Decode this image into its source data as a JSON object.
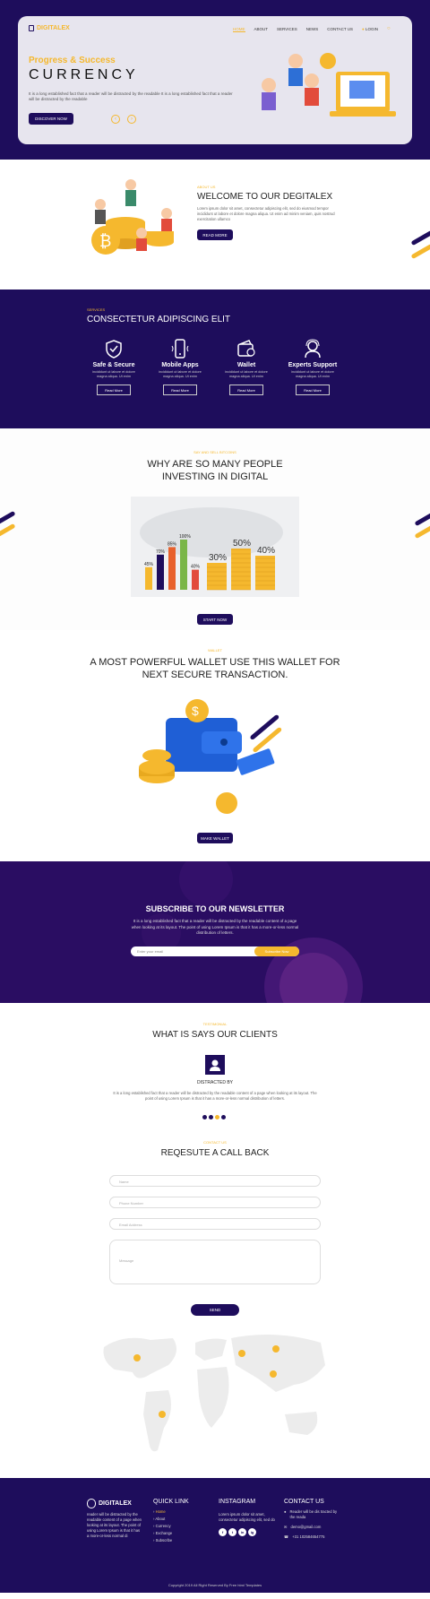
{
  "nav": {
    "brand": "DIGITALEX",
    "items": [
      "HOME",
      "ABOUT",
      "SERVICES",
      "NEWS",
      "CONTACT US",
      "LOGIN"
    ]
  },
  "hero": {
    "subtitle": "Progress & Success",
    "title": "CURRENCY",
    "desc": "It is a long established fact that a reader will be distracted by the readable It is a long established fact that a reader will be distracted by the readable",
    "button": "DISCOVER NOW"
  },
  "welcome": {
    "tag": "ABOUT US",
    "title": "WELCOME TO OUR DEGITALEX",
    "desc": "Lorem ipsum dolor sit amet, consectetur adipiscing elit, sed do eiusmod tempor incididunt ut labore et dolore magna aliqua. Ut enim ad minim veniam, quis nostrud exercitation ullamco",
    "button": "READ MORE"
  },
  "services": {
    "tag": "SERVICES",
    "title": "CONSECTETUR ADIPISCING ELIT",
    "items": [
      {
        "title": "Safe & Secure",
        "desc": "incididunt ut labore et dolore magna aliqua. Ut enim",
        "button": "Read More",
        "icon": "shield-icon"
      },
      {
        "title": "Mobile Apps",
        "desc": "incididunt ut labore et dolore magna aliqua. Ut enim",
        "button": "Read More",
        "icon": "mobile-icon"
      },
      {
        "title": "Wallet",
        "desc": "incididunt ut labore et dolore magna aliqua. Ut enim",
        "button": "Read More",
        "icon": "wallet-icon"
      },
      {
        "title": "Experts Support",
        "desc": "incididunt ut labore et dolore magna aliqua. Ut enim",
        "button": "Read More",
        "icon": "support-icon"
      }
    ]
  },
  "why": {
    "tag": "SAY AND SELL BITCOINS",
    "title1": "WHY ARE SO MANY PEOPLE",
    "title2": "INVESTING IN DIGITAL",
    "button": "START NOW"
  },
  "chart_data": {
    "type": "bar",
    "categories": [
      "1",
      "2",
      "3",
      "4",
      "5"
    ],
    "values": [
      45,
      70,
      85,
      100,
      40
    ],
    "labels": [
      "45%",
      "70%",
      "85%",
      "100%",
      "40%"
    ],
    "coin_labels": [
      "30%",
      "50%",
      "40%"
    ],
    "ylim": [
      0,
      100
    ],
    "colors": [
      "#f5b82e",
      "#1e0d5c",
      "#e8612c",
      "#7ab648",
      "#e24b3b"
    ]
  },
  "wallet": {
    "tag": "WALLET",
    "title1": "A MOST POWERFUL WALLET USE THIS WALLET FOR",
    "title2": "NEXT SECURE TRANSACTION.",
    "button": "MAKE WALLET"
  },
  "newsletter": {
    "title": "SUBSCRIBE TO OUR NEWSLETTER",
    "desc": "It is a long established fact that a reader will be distracted by the readable content of a page when looking at its layout. The point of using Lorem Ipsum is that it has a more-or-less normal distribution of letters.",
    "placeholder": "Enter your email",
    "button": "Subscribe Now"
  },
  "testimonial": {
    "tag": "TESTIMONIAL",
    "title": "WHAT IS SAYS OUR CLIENTS",
    "name": "DISTRACTED BY",
    "text": "It is a long established fact that a reader will be distracted by the readable content of a page when looking at its layout. The point of using Lorem Ipsum is that it has a more-or-less normal distribution of letters.",
    "dot_colors": [
      "#1e0d5c",
      "#1e0d5c",
      "#f5b82e",
      "#1e0d5c"
    ]
  },
  "contact": {
    "tag": "CONTACT US",
    "title": "REQESUTE A CALL BACK",
    "fields": [
      "Name",
      "Phone Number",
      "Email Address",
      "Message"
    ],
    "button": "SEND"
  },
  "footer": {
    "brand": "DIGITALEX",
    "about": "reader will be distracted by the readable content of a page when looking at its layout. The point of using Lorem Ipsum is that it has a more-or-less normal di",
    "quick_title": "QUICK LINK",
    "links": [
      "Home",
      "About",
      "Currency",
      "Exchange",
      "Subscribe"
    ],
    "insta_title": "INSTAGRAM",
    "insta_text": "Lorem ipsum dolor sit amet, consectetur adipiscing elit, sed do",
    "social": [
      "f",
      "t",
      "in",
      "ig"
    ],
    "contact_title": "CONTACT US",
    "address": "Reader will be dis tracted by the reada",
    "email": "demo@gmail.com",
    "phone": "+31 102584654775",
    "copyright": "Copyright 2019 All Right Reserved By Free html Templates"
  }
}
